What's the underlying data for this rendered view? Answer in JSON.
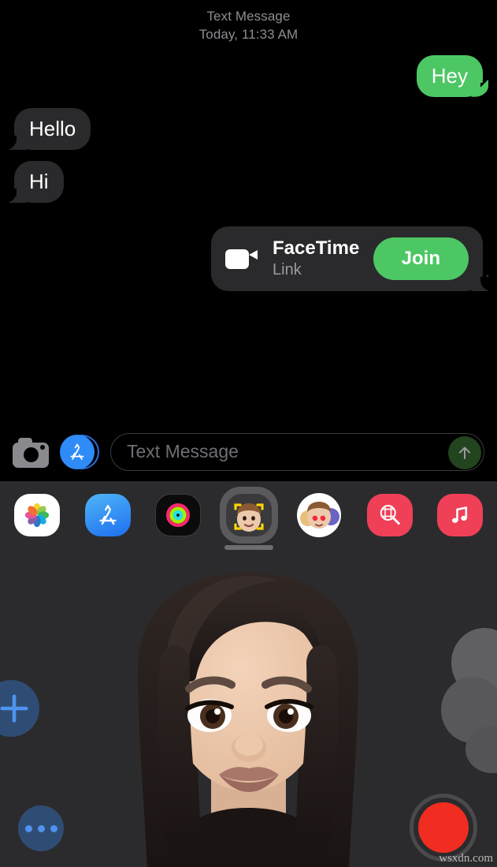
{
  "app": {
    "name": "Messages",
    "platform": "iOS",
    "theme": "dark"
  },
  "thread": {
    "header": {
      "service": "Text Message",
      "timestamp": "Today, 11:33 AM"
    },
    "messages": [
      {
        "id": "m1",
        "direction": "sent",
        "type": "text",
        "text": "Hey"
      },
      {
        "id": "m2",
        "direction": "received",
        "type": "text",
        "text": "Hello"
      },
      {
        "id": "m3",
        "direction": "received",
        "type": "text",
        "text": "Hi"
      }
    ],
    "link_card": {
      "icon": "video-camera-icon",
      "title": "FaceTime",
      "subtitle": "Link",
      "action_label": "Join",
      "direction": "sent"
    }
  },
  "input_bar": {
    "camera_icon": "camera-icon",
    "appstore_icon": "app-store-icon",
    "placeholder": "Text Message",
    "value": "",
    "send_icon": "send-arrow-up-icon",
    "send_enabled": false
  },
  "app_drawer": {
    "apps": [
      {
        "id": "photos",
        "label": "Photos",
        "icon": "photos-icon",
        "selected": false
      },
      {
        "id": "app-store",
        "label": "App Store",
        "icon": "app-store-icon",
        "selected": false
      },
      {
        "id": "fitness",
        "label": "Fitness",
        "icon": "activity-rings-icon",
        "selected": false
      },
      {
        "id": "memoji",
        "label": "Memoji",
        "icon": "memoji-camera-icon",
        "selected": true
      },
      {
        "id": "memoji-stickers",
        "label": "Memoji Stickers",
        "icon": "memoji-stickers-icon",
        "selected": false
      },
      {
        "id": "images",
        "label": "#images",
        "icon": "images-search-icon",
        "selected": false
      },
      {
        "id": "music",
        "label": "Music",
        "icon": "music-note-icon",
        "selected": false
      }
    ],
    "drag_handle": "drawer-drag-handle"
  },
  "memoji_panel": {
    "title": "Memoji",
    "add_button": {
      "icon": "plus-icon",
      "label": "New Memoji"
    },
    "more_button": {
      "icon": "ellipsis-icon",
      "label": "More Options"
    },
    "record_button": {
      "icon": "record-icon",
      "label": "Record",
      "recording": false
    },
    "character": {
      "name": "memoji-avatar",
      "hair_color": "#221c1a",
      "skin_color": "#ecc6ab",
      "lip_color": "#a8776a"
    }
  },
  "colors": {
    "sent_bubble": "#4DC764",
    "received_bubble": "#2a2a2c",
    "background": "#000000",
    "drawer_background": "#2b2b2d",
    "accent_blue": "#2e8bf7",
    "record_red": "#f02d20",
    "secondary_text": "#8d8d92"
  },
  "watermark": {
    "text": "wsxdn.com"
  }
}
